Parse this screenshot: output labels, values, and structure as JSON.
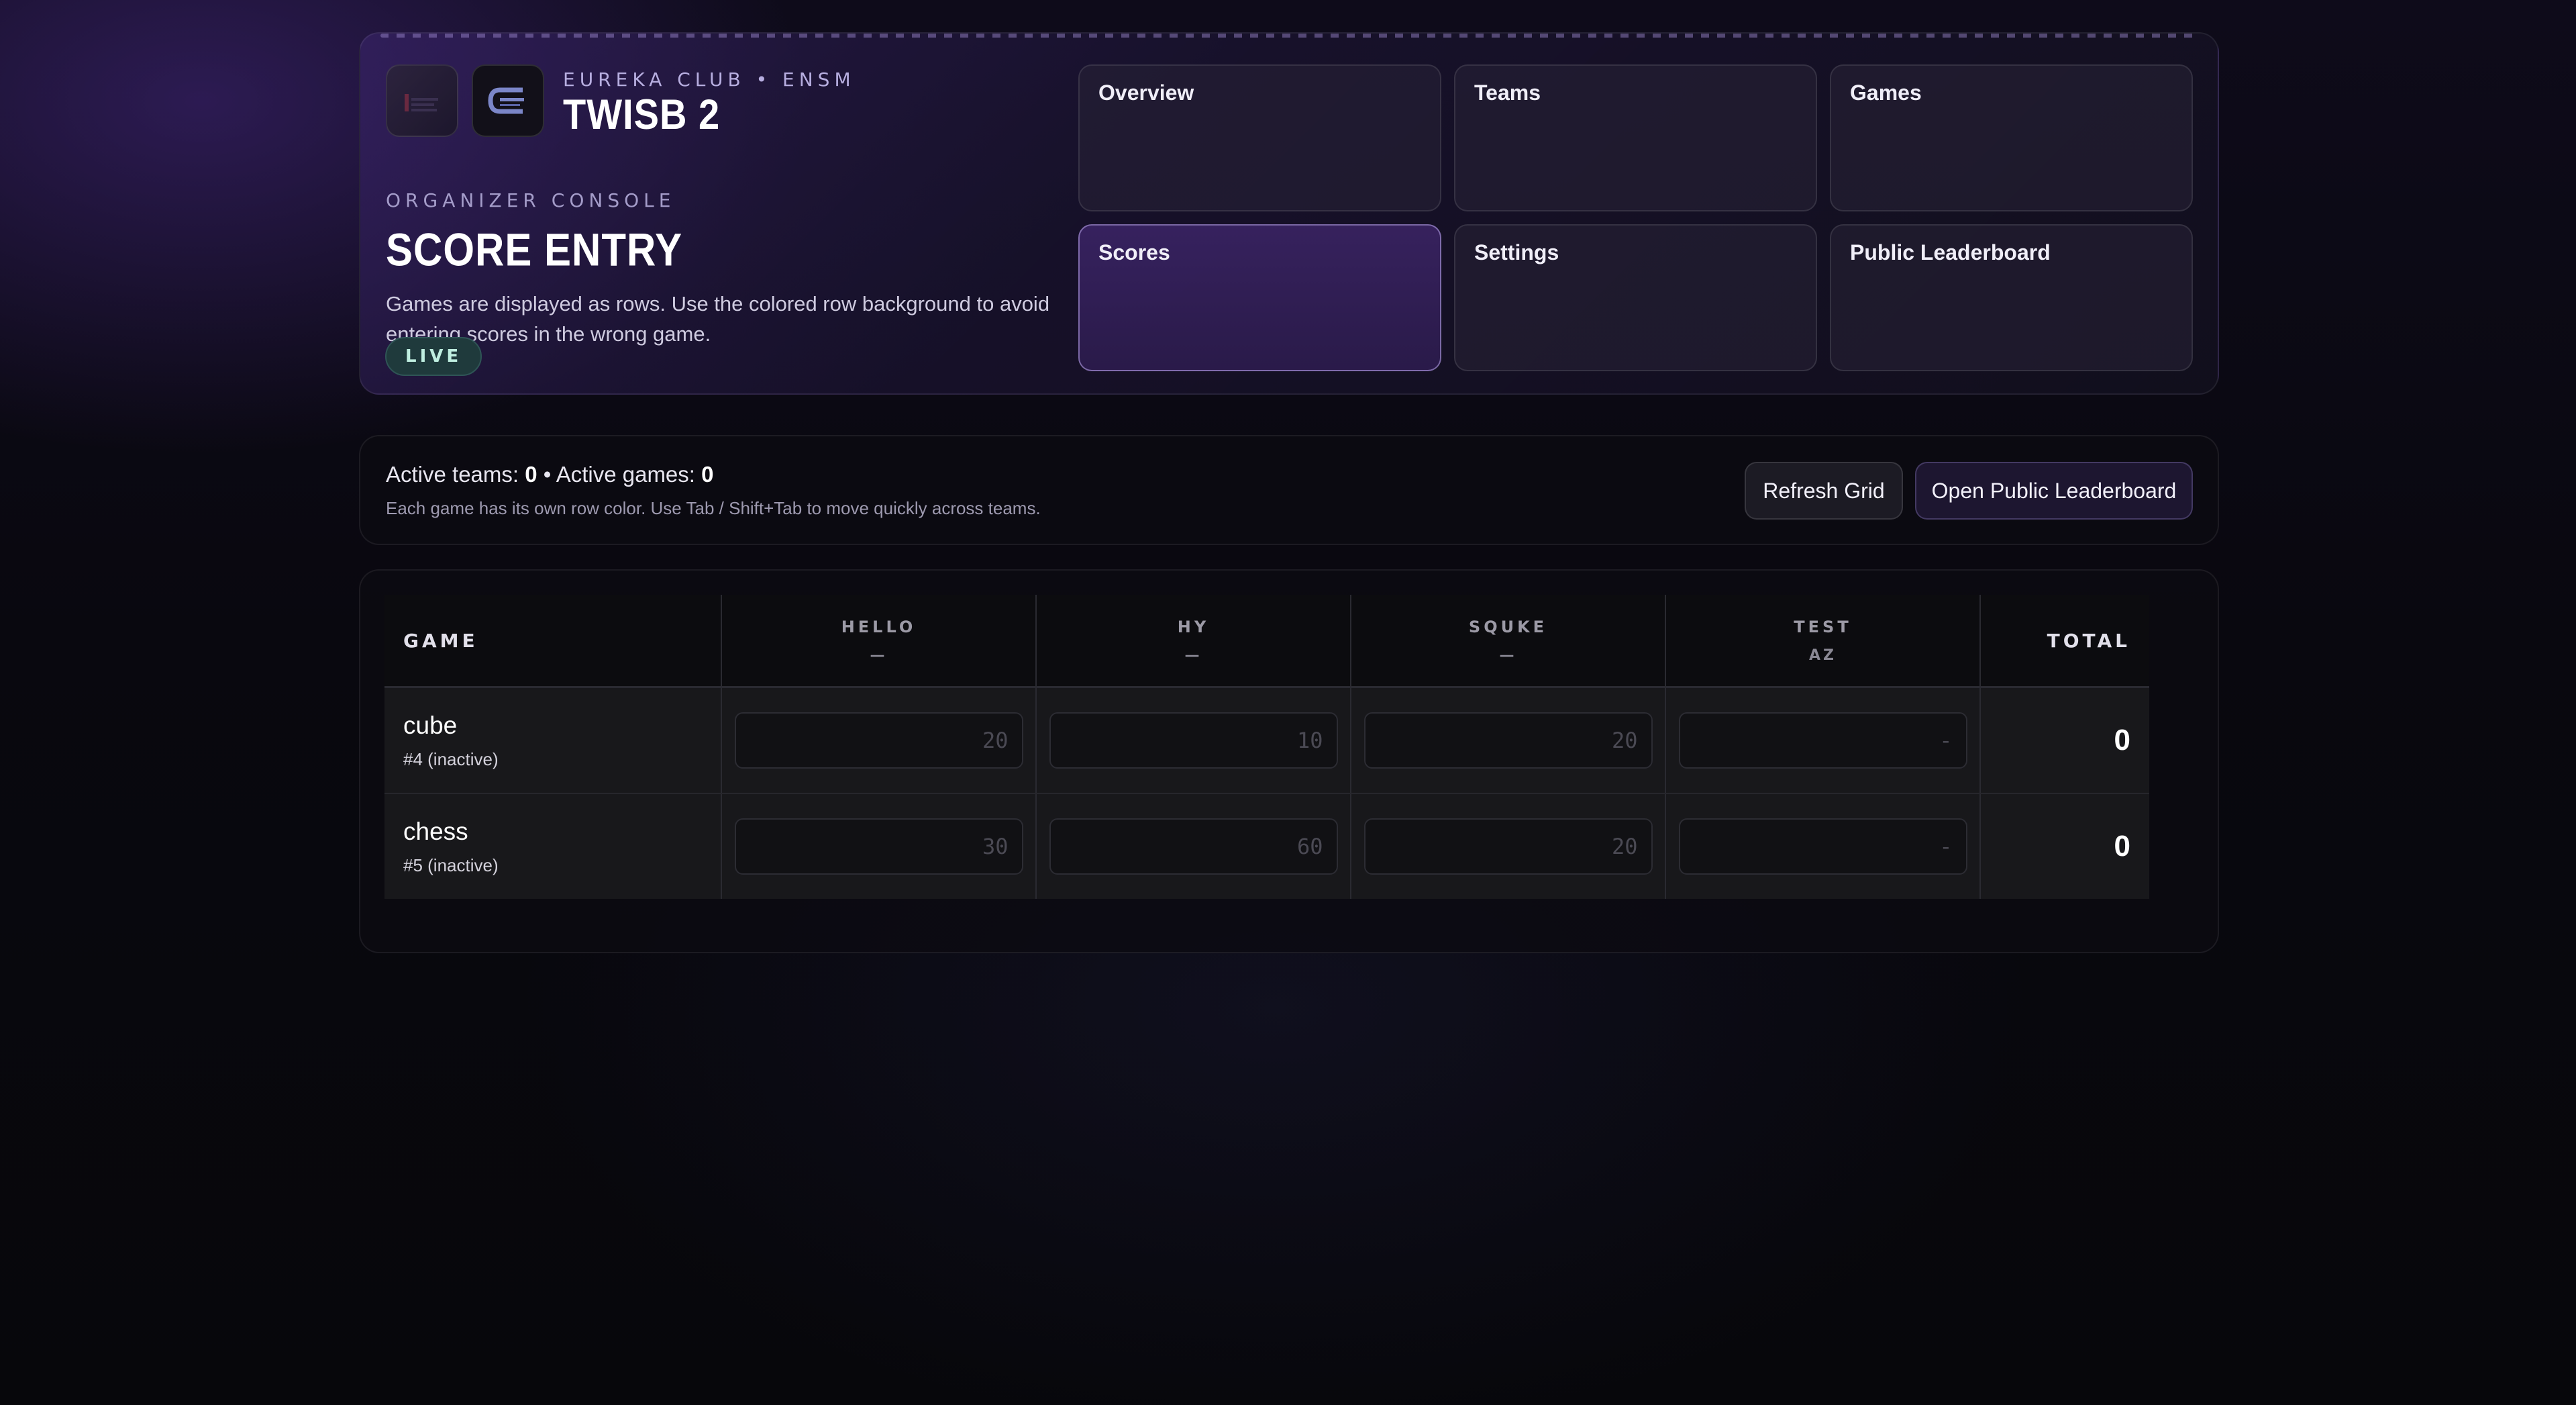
{
  "header": {
    "club": "EUREKA CLUB • ENSM",
    "event": "TWISB 2",
    "console_label": "ORGANIZER CONSOLE",
    "page_title": "SCORE ENTRY",
    "description": "Games are displayed as rows. Use the colored row background to avoid entering scores in the wrong game.",
    "status_badge": "LIVE"
  },
  "nav": {
    "overview": "Overview",
    "teams": "Teams",
    "games": "Games",
    "scores": "Scores",
    "settings": "Settings",
    "public_leaderboard": "Public Leaderboard",
    "active": "Scores"
  },
  "stats": {
    "active_teams_label": "Active teams:",
    "active_teams": "0",
    "separator": "•",
    "active_games_label": "Active games:",
    "active_games": "0",
    "hint": "Each game has its own row color. Use Tab / Shift+Tab to move quickly across teams.",
    "refresh_button": "Refresh Grid",
    "public_button": "Open Public Leaderboard"
  },
  "table": {
    "game_header": "GAME",
    "total_header": "TOTAL",
    "teams": [
      {
        "name": "HELLO",
        "sub": "—"
      },
      {
        "name": "HY",
        "sub": "—"
      },
      {
        "name": "SQUKE",
        "sub": "—"
      },
      {
        "name": "TEST",
        "sub": "AZ"
      }
    ],
    "rows": [
      {
        "game": "cube",
        "meta": "#4 (inactive)",
        "placeholders": [
          "20",
          "10",
          "20",
          "-"
        ],
        "total": "0"
      },
      {
        "game": "chess",
        "meta": "#5 (inactive)",
        "placeholders": [
          "30",
          "60",
          "20",
          "-"
        ],
        "total": "0"
      }
    ]
  },
  "colors": {
    "accent": "#3a2464",
    "live_badge_bg": "#1f3a3c",
    "live_badge_text": "#bfeee0"
  }
}
